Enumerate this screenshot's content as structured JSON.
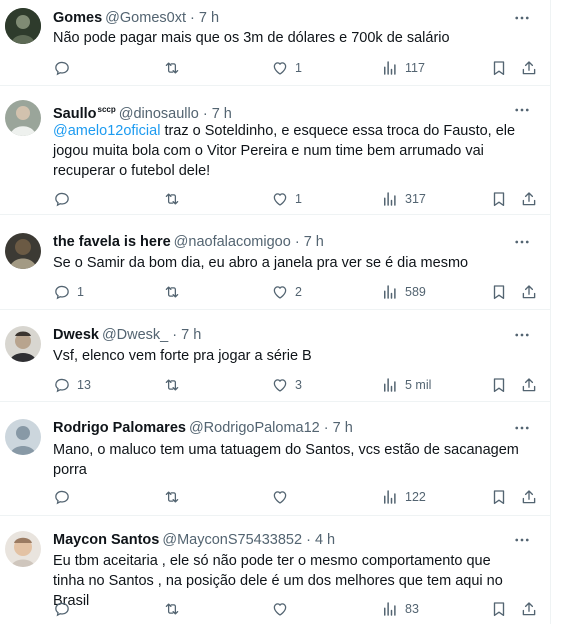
{
  "tweets": [
    {
      "name": "Gomes",
      "name_sup": "",
      "handle": "@Gomes0xt",
      "dot": "·",
      "time": "7 h",
      "mention": "",
      "text": "Não pode pagar mais que os 3m de dólares e 700k de salário",
      "lines": [],
      "replies": "",
      "retweets": "",
      "likes": "1",
      "views": "117"
    },
    {
      "name": "Saullo",
      "name_sup": "sccp",
      "handle": "@dinosaullo",
      "dot": "·",
      "time": "7 h",
      "mention": "@amelo12oficial",
      "text": " traz o Soteldinho, e esquece essa troca do Fausto, ele jogou muita bola com o Vitor Pereira e num time bem arrumado vai recuperar o futebol dele!",
      "replies": "",
      "retweets": "",
      "likes": "1",
      "views": "317"
    },
    {
      "name": "the favela is here",
      "name_sup": "",
      "handle": "@naofalacomigoo",
      "dot": "·",
      "time": "7 h",
      "mention": "",
      "text": "Se o Samir da bom dia, eu abro a janela pra ver se é dia mesmo",
      "replies": "1",
      "retweets": "",
      "likes": "2",
      "views": "589"
    },
    {
      "name": "Dwesk",
      "name_sup": "",
      "handle": "@Dwesk_",
      "dot": "·",
      "time": "7 h",
      "mention": "",
      "text": "Vsf, elenco vem forte pra jogar a série B",
      "replies": "13",
      "retweets": "",
      "likes": "3",
      "views": "5 mil"
    },
    {
      "name": "Rodrigo Palomares",
      "name_sup": "",
      "handle": "@RodrigoPaloma12",
      "dot": "·",
      "time": "7 h",
      "mention": "",
      "text": "Mano, o maluco tem uma tatuagem do Santos, vcs estão de sacanagem porra",
      "replies": "",
      "retweets": "",
      "likes": "",
      "views": "122"
    },
    {
      "name": "Maycon Santos",
      "name_sup": "",
      "handle": "@MayconS75433852",
      "dot": "·",
      "time": "4 h",
      "mention": "",
      "text": "Eu tbm aceitaria , ele só não pode ter o mesmo comportamento que tinha no Santos , na posição dele é um dos melhores que tem aqui no Brasil",
      "replies": "",
      "retweets": "",
      "likes": "",
      "views": "83"
    }
  ],
  "colors": {
    "text": "#0f1419",
    "secondary": "#536471",
    "link": "#1d9bf0",
    "divider": "#eff3f4"
  },
  "icons": [
    "reply-icon",
    "retweet-icon",
    "like-icon",
    "views-icon",
    "bookmark-icon",
    "share-icon",
    "more-icon"
  ]
}
